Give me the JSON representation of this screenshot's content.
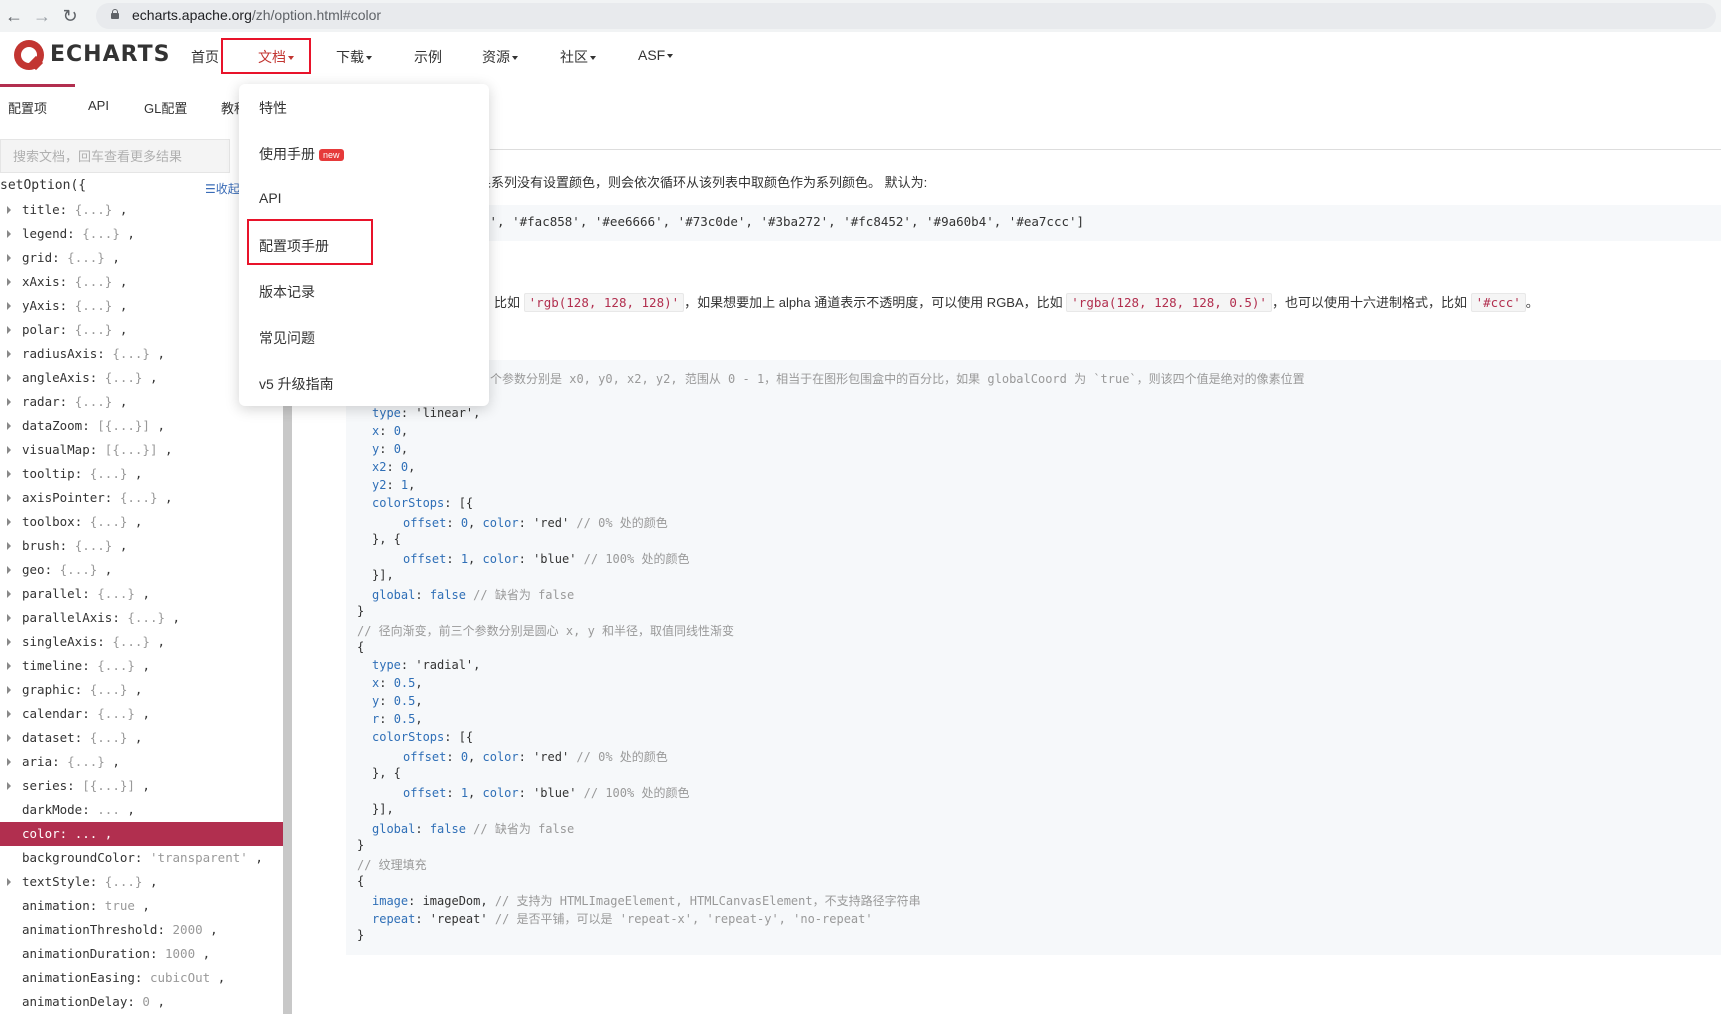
{
  "browser": {
    "url_domain": "echarts.apache.org",
    "url_path": "/zh/option.html#color"
  },
  "nav": {
    "logo": "ECHARTS",
    "items": [
      {
        "label": "首页"
      },
      {
        "label": "文档"
      },
      {
        "label": "下载"
      },
      {
        "label": "示例"
      },
      {
        "label": "资源"
      },
      {
        "label": "社区"
      },
      {
        "label": "ASF"
      }
    ]
  },
  "subtabs": [
    "配置项",
    "API",
    "GL配置",
    "教程"
  ],
  "dropdown": {
    "items": [
      "特性",
      "使用手册",
      "API",
      "配置项手册",
      "版本记录",
      "常见问题",
      "v5 升级指南"
    ],
    "badge": "new"
  },
  "sidebar": {
    "search_placeholder": "搜索文档，回车查看更多结果",
    "root": "setOption({",
    "collapse": "☰收起",
    "rows": [
      {
        "key": "title",
        "val": "{...}"
      },
      {
        "key": "legend",
        "val": "{...}"
      },
      {
        "key": "grid",
        "val": "{...}"
      },
      {
        "key": "xAxis",
        "val": "{...}"
      },
      {
        "key": "yAxis",
        "val": "{...}"
      },
      {
        "key": "polar",
        "val": "{...}"
      },
      {
        "key": "radiusAxis",
        "val": "{...}"
      },
      {
        "key": "angleAxis",
        "val": "{...}"
      },
      {
        "key": "radar",
        "val": "{...}"
      },
      {
        "key": "dataZoom",
        "val": "[{...}]"
      },
      {
        "key": "visualMap",
        "val": "[{...}]"
      },
      {
        "key": "tooltip",
        "val": "{...}"
      },
      {
        "key": "axisPointer",
        "val": "{...}"
      },
      {
        "key": "toolbox",
        "val": "{...}"
      },
      {
        "key": "brush",
        "val": "{...}"
      },
      {
        "key": "geo",
        "val": "{...}"
      },
      {
        "key": "parallel",
        "val": "{...}"
      },
      {
        "key": "parallelAxis",
        "val": "{...}"
      },
      {
        "key": "singleAxis",
        "val": "{...}"
      },
      {
        "key": "timeline",
        "val": "{...}"
      },
      {
        "key": "graphic",
        "val": "{...}"
      },
      {
        "key": "calendar",
        "val": "{...}"
      },
      {
        "key": "dataset",
        "val": "{...}"
      },
      {
        "key": "aria",
        "val": "{...}"
      },
      {
        "key": "series",
        "val": "[{...}]"
      },
      {
        "key": "darkMode",
        "val": "..."
      },
      {
        "key": "color",
        "val": "..."
      },
      {
        "key": "backgroundColor",
        "val": "'transparent'"
      },
      {
        "key": "textStyle",
        "val": "{...}"
      },
      {
        "key": "animation",
        "val": "true"
      },
      {
        "key": "animationThreshold",
        "val": "2000"
      },
      {
        "key": "animationDuration",
        "val": "1000"
      },
      {
        "key": "animationEasing",
        "val": "cubicOut"
      },
      {
        "key": "animationDelay",
        "val": "0"
      }
    ]
  },
  "content": {
    "intro": "如果系列没有设置颜色，则会依次循环从该列表中取颜色作为系列颜色。 默认为:",
    "default_colors": "5', '#fac858', '#ee6666', '#73c0de', '#3ba272', '#fc8452', '#9a60b4', '#ea7ccc']",
    "color_desc_1": "比如",
    "color_rgb": "'rgb(128, 128, 128)'",
    "color_desc_2": "，如果想要加上 alpha 通道表示不透明度，可以使用 RGBA，比如",
    "color_rgba": "'rgba(128, 128, 128, 0.5)'",
    "color_desc_3": "，也可以使用十六进制格式，比如",
    "color_hex": "'#ccc'",
    "color_desc_4": "。",
    "code_comment_1": "个参数分别是 x0, y0, x2, y2, 范围从 0 - 1，相当于在图形包围盒中的百分比，如果 globalCoord 为 `true`，则该四个值是绝对的像素位置"
  }
}
